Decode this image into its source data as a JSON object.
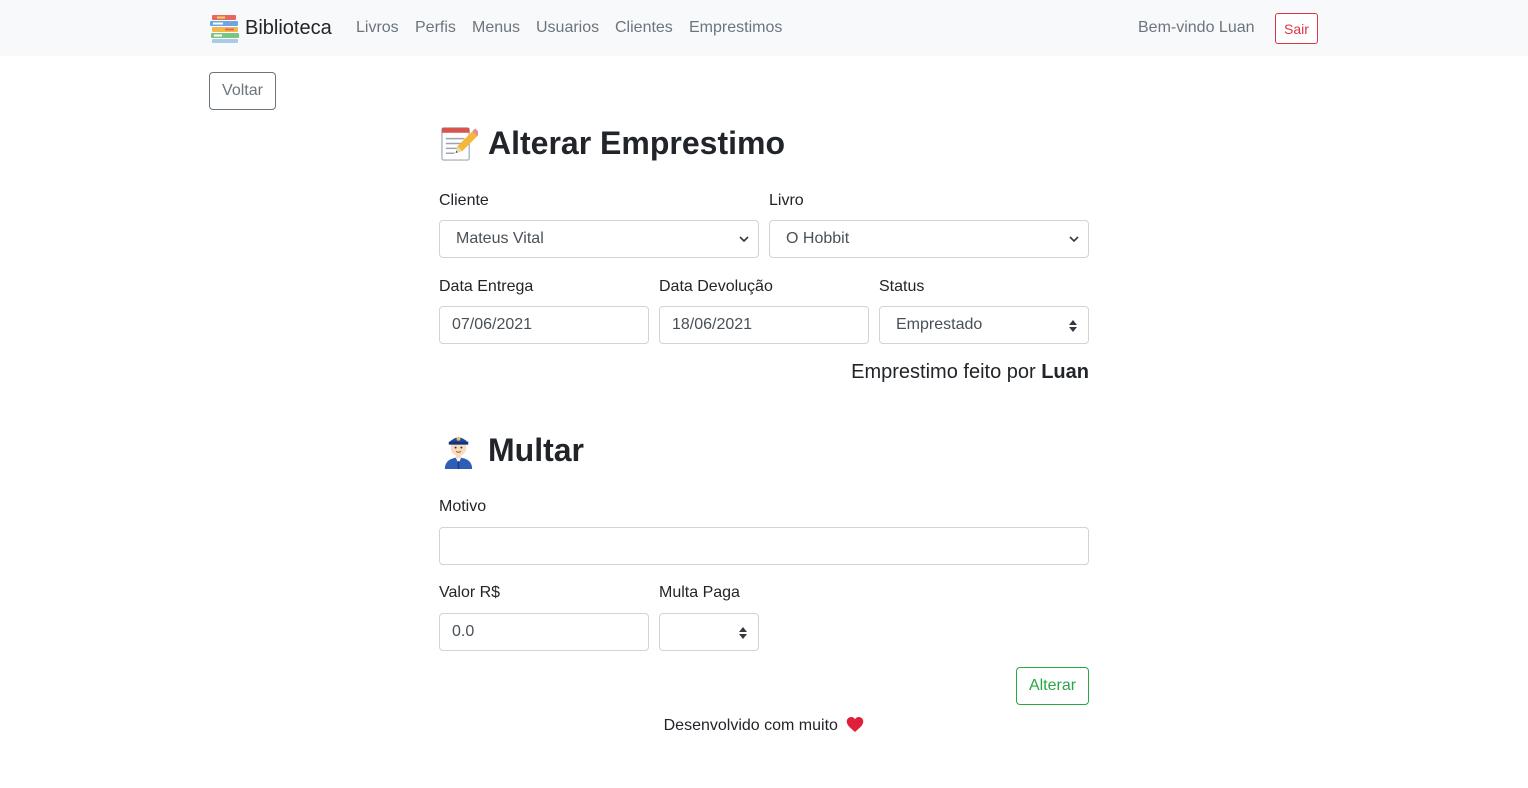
{
  "navbar": {
    "brand": "Biblioteca",
    "brand_icon": "books-icon",
    "links": [
      "Livros",
      "Perfis",
      "Menus",
      "Usuarios",
      "Clientes",
      "Emprestimos"
    ],
    "welcome": "Bem-vindo Luan",
    "logout": "Sair"
  },
  "back_button": "Voltar",
  "loan_form": {
    "title": "Alterar Emprestimo",
    "title_icon": "memo-icon",
    "cliente_label": "Cliente",
    "cliente_value": "Mateus Vital",
    "livro_label": "Livro",
    "livro_value": "O Hobbit",
    "data_entrega_label": "Data Entrega",
    "data_entrega_value": "07/06/2021",
    "data_devolucao_label": "Data Devolução",
    "data_devolucao_value": "18/06/2021",
    "status_label": "Status",
    "status_value": "Emprestado",
    "made_by_prefix": "Emprestimo feito por",
    "made_by_user": "Luan"
  },
  "fine_form": {
    "title": "Multar",
    "title_icon": "police-officer-icon",
    "motivo_label": "Motivo",
    "motivo_value": "",
    "valor_label": "Valor R$",
    "valor_value": "0.0",
    "multa_paga_label": "Multa Paga",
    "multa_paga_value": "",
    "submit": "Alterar"
  },
  "footer": {
    "text": "Desenvolvido com muito",
    "icon": "heart-icon"
  },
  "colors": {
    "danger": "#dc3545",
    "success": "#28a745",
    "secondary": "#6c757d",
    "navbar_bg": "#f8f9fa"
  }
}
